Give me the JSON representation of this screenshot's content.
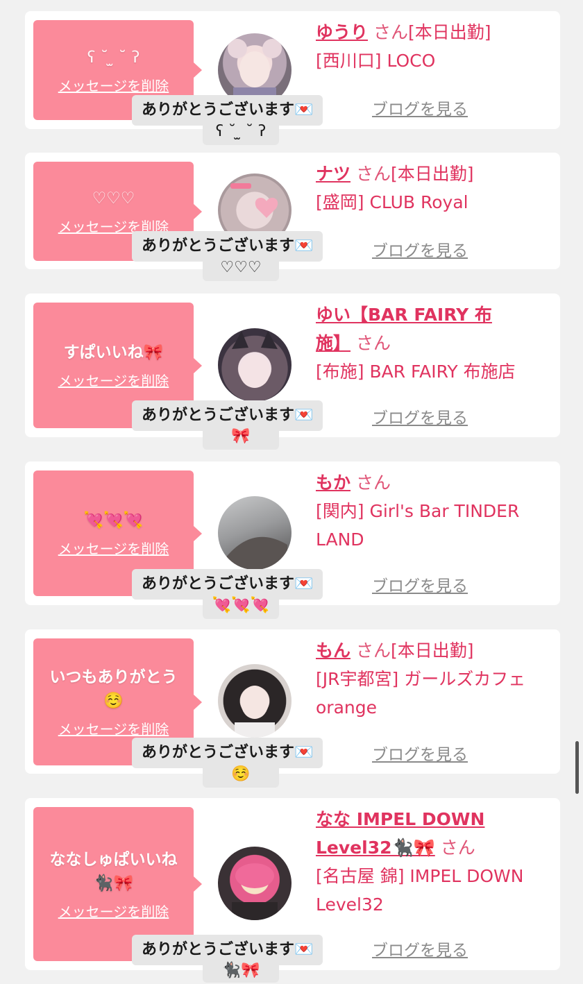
{
  "cards": [
    {
      "message": "ʕ ˘ ̫ ˘ ʔ",
      "delete_label": "メッセージを削除",
      "name": "ゆうり",
      "san": "さん",
      "status": "[本日出勤]",
      "area": "[西川口]",
      "shop": "LOCO",
      "blog_label": "ブログを見る",
      "thanks_label": "ありがとうございます💌",
      "reply_emoji": "ʕ ˘ ̫ ˘ ʔ"
    },
    {
      "message": "♡♡♡",
      "delete_label": "メッセージを削除",
      "name": "ナツ",
      "san": "さん",
      "status": "[本日出勤]",
      "area": "[盛岡]",
      "shop": "CLUB Royal",
      "blog_label": "ブログを見る",
      "thanks_label": "ありがとうございます💌",
      "reply_emoji": "♡♡♡"
    },
    {
      "message": "すぱいいね🎀",
      "delete_label": "メッセージを削除",
      "name": "ゆい【BAR FAIRY 布施】",
      "san": "さん",
      "status": "",
      "area": "[布施]",
      "shop": "BAR FAIRY 布施店",
      "blog_label": "ブログを見る",
      "thanks_label": "ありがとうございます💌",
      "reply_emoji": "🎀"
    },
    {
      "message": "💘💘💘",
      "delete_label": "メッセージを削除",
      "name": "もか",
      "san": "さん",
      "status": "",
      "area": "[関内]",
      "shop": "Girl's Bar TINDER LAND",
      "blog_label": "ブログを見る",
      "thanks_label": "ありがとうございます💌",
      "reply_emoji": "💘💘💘"
    },
    {
      "message": "いつもありがとう☺️",
      "delete_label": "メッセージを削除",
      "name": "もん",
      "san": "さん",
      "status": "[本日出勤]",
      "area": "[JR宇都宮]",
      "shop": "ガールズカフェ orange",
      "blog_label": "ブログを見る",
      "thanks_label": "ありがとうございます💌",
      "reply_emoji": "☺️"
    },
    {
      "message": "ななしゅぱいいね🐈‍⬛🎀",
      "delete_label": "メッセージを削除",
      "name": "なな IMPEL DOWN Level32🐈‍⬛🎀",
      "san": "さん",
      "status": "",
      "area": "[名古屋 錦]",
      "shop": "IMPEL DOWN Level32",
      "blog_label": "ブログを見る",
      "thanks_label": "ありがとうございます💌",
      "reply_emoji": "🐈‍⬛🎀"
    }
  ],
  "colors": {
    "accent": "#e0335f",
    "bubble": "#fb8a9a",
    "background": "#f1f1f1",
    "thanks_bg": "#e6e6e6"
  }
}
